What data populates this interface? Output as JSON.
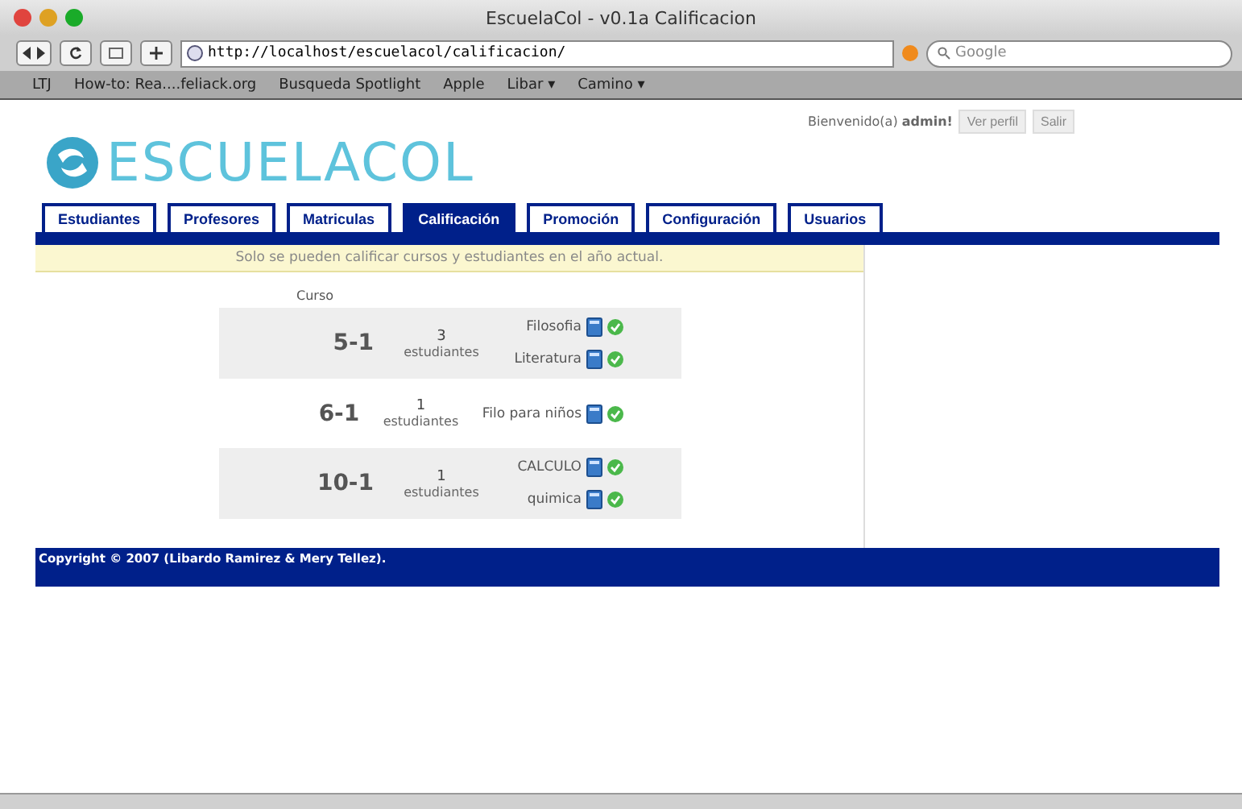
{
  "window": {
    "title": "EscuelaCol - v0.1a Calificacion"
  },
  "toolbar": {
    "url": "http://localhost/escuelacol/calificacion/",
    "search_placeholder": "Google"
  },
  "bookmarks": [
    "How-to: Rea....feliack.org",
    "Busqueda Spotlight",
    "Apple",
    "Libar ▾",
    "Camino ▾"
  ],
  "bookmarks_icon": "LTJ",
  "user_bar": {
    "greeting": "Bienvenido(a) **admin!**",
    "buttons": [
      "Ver perfil",
      "Salir"
    ]
  },
  "logo": "ESCUELACOL",
  "tabs": [
    {
      "label": "Estudiantes",
      "selected": false
    },
    {
      "label": "Profesores",
      "selected": false
    },
    {
      "label": "Matriculas",
      "selected": false
    },
    {
      "label": "Calificación",
      "selected": true
    },
    {
      "label": "Promoción",
      "selected": false
    },
    {
      "label": "Configuración",
      "selected": false
    },
    {
      "label": "Usuarios",
      "selected": false
    }
  ],
  "notice": "Solo se pueden calificar cursos y estudiantes en el año actual.",
  "table": {
    "column_header": "Curso",
    "rows": [
      {
        "course": "5-1",
        "count": "3",
        "count_label": "estudiantes",
        "subjects": [
          "Filosofia",
          "Literatura"
        ]
      },
      {
        "course": "6-1",
        "count": "1",
        "count_label": "estudiantes",
        "subjects": [
          "Filo para niños"
        ]
      },
      {
        "course": "10-1",
        "count": "1",
        "count_label": "estudiantes",
        "subjects": [
          "CALCULO",
          "quimica"
        ]
      }
    ]
  },
  "footer": "Copyright © 2007 (Libardo Ramirez & Mery Tellez)."
}
